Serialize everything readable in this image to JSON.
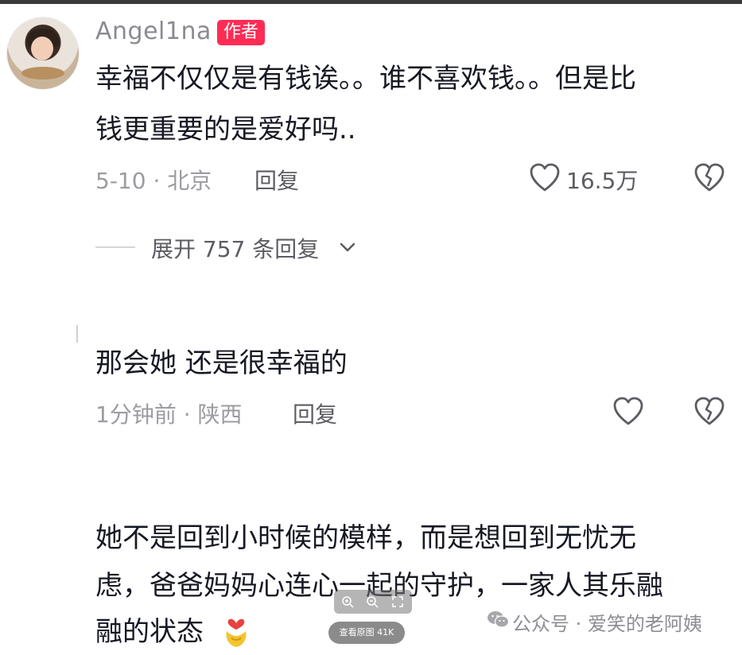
{
  "comments": [
    {
      "username": "Angel1na",
      "badge": "作者",
      "text_line1": "幸福不仅仅是有钱诶。。谁不喜欢钱。。但是比",
      "text_line2": "钱更重要的是爱好吗..",
      "meta": "5-10 · 北京",
      "reply": "回复",
      "like_count": "16.5万",
      "expand_replies": "展开 757 条回复"
    },
    {
      "text": "那会她 还是很幸福的",
      "meta": "1分钟前 · 陕西",
      "reply": "回复"
    },
    {
      "text_line1": "她不是回到小时候的模样，而是想回到无忧无",
      "text_line2": "虑，爸爸妈妈心连心一起的守护，一家人其乐融",
      "text_line3": "融的状态"
    }
  ],
  "image_viewer": {
    "view_original": "查看原图 41K"
  },
  "watermark": {
    "text": "公众号 · 爱笑的老阿姨"
  },
  "icons": {
    "like": "heart-outline-icon",
    "dislike": "broken-heart-icon",
    "chevron": "chevron-down-icon",
    "zoom_in": "zoom-in-icon",
    "zoom_out": "zoom-out-icon",
    "fit": "fit-screen-icon",
    "wechat": "wechat-icon",
    "emoji": "hands-heart-emoji"
  },
  "colors": {
    "badge": "#fe2c55",
    "text": "#161823",
    "meta": "#9b9ca1"
  }
}
